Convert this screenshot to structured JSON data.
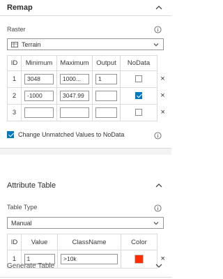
{
  "remap": {
    "title": "Remap",
    "raster_label": "Raster",
    "raster_value": "Terrain",
    "columns": [
      "ID",
      "Minimum",
      "Maximum",
      "Output",
      "NoData"
    ],
    "rows": [
      {
        "id": "1",
        "minimum": "3048",
        "maximum": "1000...",
        "output": "1",
        "nodata": false
      },
      {
        "id": "2",
        "minimum": "-1000",
        "maximum": "3047.99",
        "output": "",
        "nodata": true
      },
      {
        "id": "3",
        "minimum": "",
        "maximum": "",
        "output": "",
        "nodata": false
      }
    ],
    "remove_glyph": "×",
    "unmatched_label": "Change Unmatched Values to NoData",
    "unmatched_checked": true
  },
  "attribute_table": {
    "title": "Attribute Table",
    "table_type_label": "Table Type",
    "table_type_value": "Manual",
    "columns": [
      "ID",
      "Value",
      "ClassName",
      "Color"
    ],
    "rows": [
      {
        "id": "1",
        "value": "1",
        "classname": ">10k",
        "color": "#ff2d00"
      }
    ],
    "remove_glyph": "×"
  },
  "generate_table": {
    "title": "Generate Table"
  },
  "icons": {
    "remap_chevron": "chevron-up-icon",
    "attribute_chevron": "chevron-up-icon",
    "generate_chevron": "chevron-down-icon",
    "info": "info-icon",
    "raster": "raster-layer-icon"
  },
  "colors": {
    "accent": "#0079c1",
    "border": "#dadada",
    "background_band": "#f3f3f3"
  }
}
